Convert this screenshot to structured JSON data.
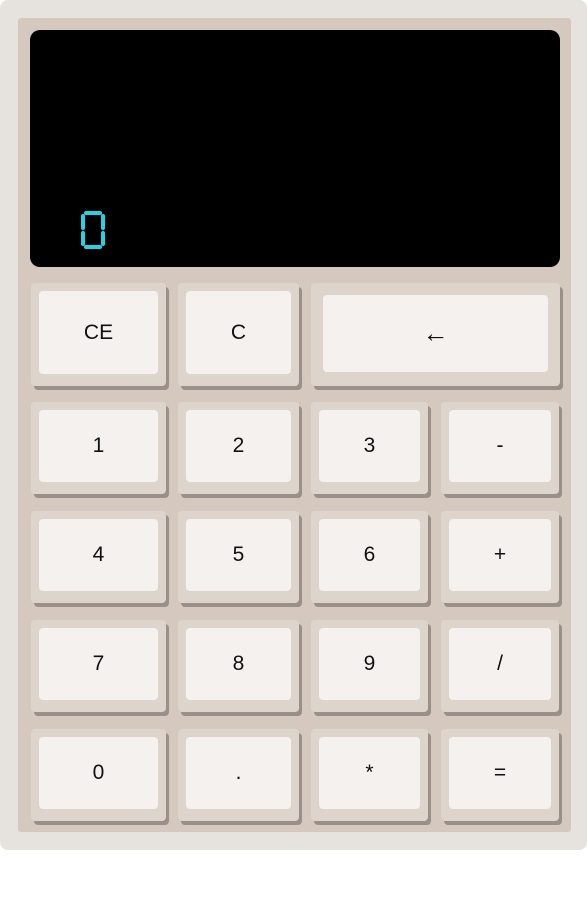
{
  "display": {
    "value": "0",
    "digit_color": "#22d3e6",
    "background": "#000000"
  },
  "keys": {
    "ce": "CE",
    "c": "C",
    "backspace": "←",
    "one": "1",
    "two": "2",
    "three": "3",
    "minus": "-",
    "four": "4",
    "five": "5",
    "six": "6",
    "plus": "+",
    "seven": "7",
    "eight": "8",
    "nine": "9",
    "divide": "/",
    "zero": "0",
    "decimal": ".",
    "multiply": "*",
    "equals": "="
  },
  "colors": {
    "frame": "#e6e2de",
    "body": "#d4c8bf",
    "key_base": "#ddd5cc",
    "key_face": "#f4f1ee",
    "key_shadow": "#9b9089"
  }
}
